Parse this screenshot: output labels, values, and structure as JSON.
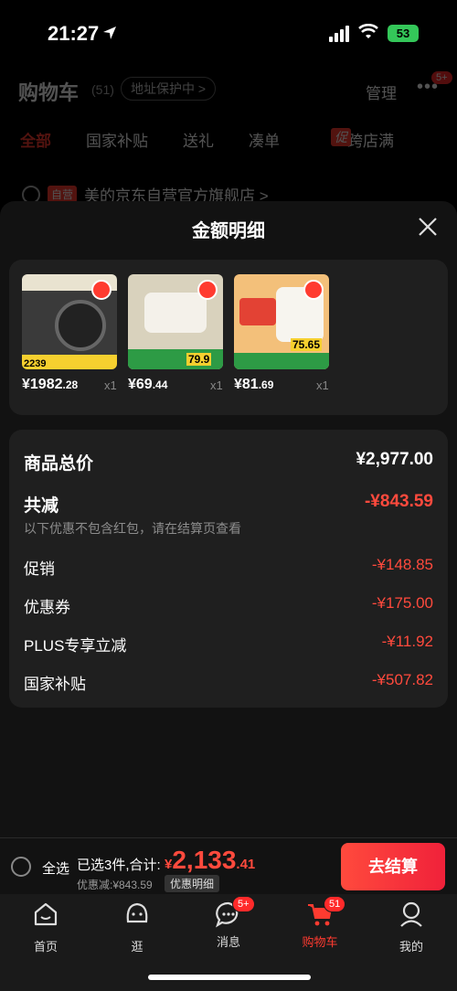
{
  "status": {
    "time": "21:27",
    "battery": "53"
  },
  "background_page": {
    "title": "购物车",
    "count": "(51)",
    "address": "地址保护中 >",
    "manage": "管理",
    "more_badge": "5+",
    "tabs": [
      "全部",
      "国家补贴",
      "送礼",
      "凑单",
      "跨店满"
    ],
    "promo_tag": "促",
    "store_tag": "自营",
    "store_name": "美的京东自营官方旗舰店 >"
  },
  "sheet": {
    "title": "金额明细",
    "products": [
      {
        "price_int": "¥1982",
        "price_dec": ".28",
        "qty": "x1",
        "thumb_color": "#3a3a3a",
        "badge": "2239"
      },
      {
        "price_int": "¥69",
        "price_dec": ".44",
        "qty": "x1",
        "thumb_color": "#e8e2d2",
        "badge": "79.9"
      },
      {
        "price_int": "¥81",
        "price_dec": ".69",
        "qty": "x1",
        "thumb_color": "#f3c07a",
        "badge": "75.65"
      }
    ],
    "total_label": "商品总价",
    "total_value": "¥2,977.00",
    "reduce_label": "共减",
    "reduce_value": "-¥843.59",
    "note": "以下优惠不包含红包，请在结算页查看",
    "items": [
      {
        "label": "促销",
        "value": "-¥148.85"
      },
      {
        "label": "优惠券",
        "value": "-¥175.00"
      },
      {
        "label": "PLUS专享立减",
        "value": "-¥11.92"
      },
      {
        "label": "国家补贴",
        "value": "-¥507.82"
      }
    ]
  },
  "bottom_bar": {
    "select_all": "全选",
    "summary": "已选3件,合计:",
    "total_symbol": "¥",
    "total_big": "2,133",
    "total_dec": ".41",
    "discount": "优惠减:¥843.59",
    "detail_link": "优惠明细",
    "checkout": "去结算"
  },
  "tabbar": {
    "home": "首页",
    "browse": "逛",
    "messages": "消息",
    "messages_badge": "5+",
    "cart": "购物车",
    "cart_badge": "51",
    "me": "我的"
  },
  "colors": {
    "accent": "#ff3b30",
    "sheet_bg": "#121212",
    "card_bg": "#1f1f1f"
  }
}
